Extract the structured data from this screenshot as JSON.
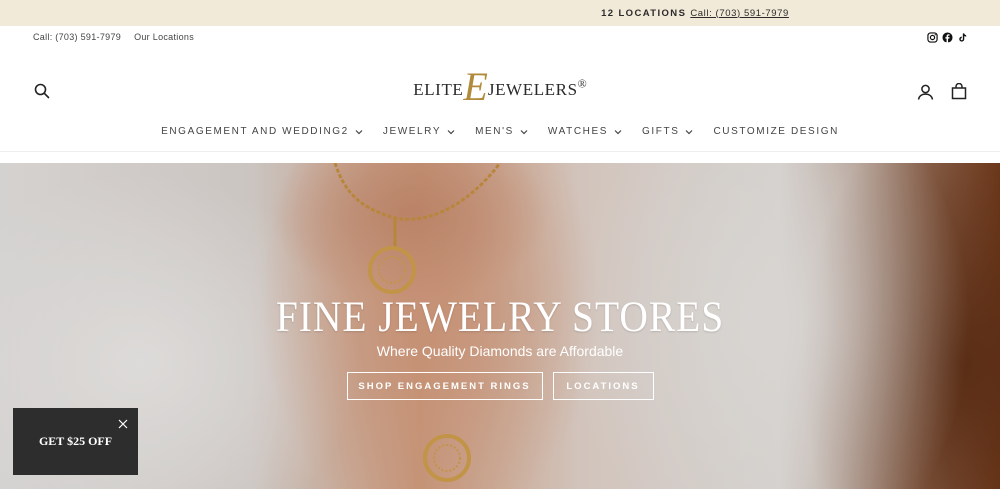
{
  "announcement": {
    "count": "12 LOCATIONS",
    "phone": "Call: (703) 591-7979"
  },
  "utility": {
    "call": "Call: (703) 591-7979",
    "locations": "Our Locations",
    "social": [
      "instagram-icon",
      "facebook-icon",
      "tiktok-icon"
    ]
  },
  "logo": {
    "left": "ELITE",
    "mark": "E",
    "right": "JEWELERS",
    "reg": "®"
  },
  "nav": {
    "items": [
      {
        "label": "ENGAGEMENT AND WEDDING2",
        "dropdown": true
      },
      {
        "label": "JEWELRY",
        "dropdown": true
      },
      {
        "label": "MEN'S",
        "dropdown": true
      },
      {
        "label": "WATCHES",
        "dropdown": true
      },
      {
        "label": "GIFTS",
        "dropdown": true
      },
      {
        "label": "CUSTOMIZE DESIGN",
        "dropdown": false
      }
    ]
  },
  "hero": {
    "title": "FINE JEWELRY STORES",
    "subtitle": "Where Quality Diamonds are Affordable",
    "primary_button": "SHOP ENGAGEMENT RINGS",
    "secondary_button": "LOCATIONS"
  },
  "promo": {
    "label": "GET $25 OFF"
  },
  "colors": {
    "announce_bg": "#f2ead8",
    "logo_gold": "#b28a3c",
    "promo_bg": "#2d2d2d"
  }
}
